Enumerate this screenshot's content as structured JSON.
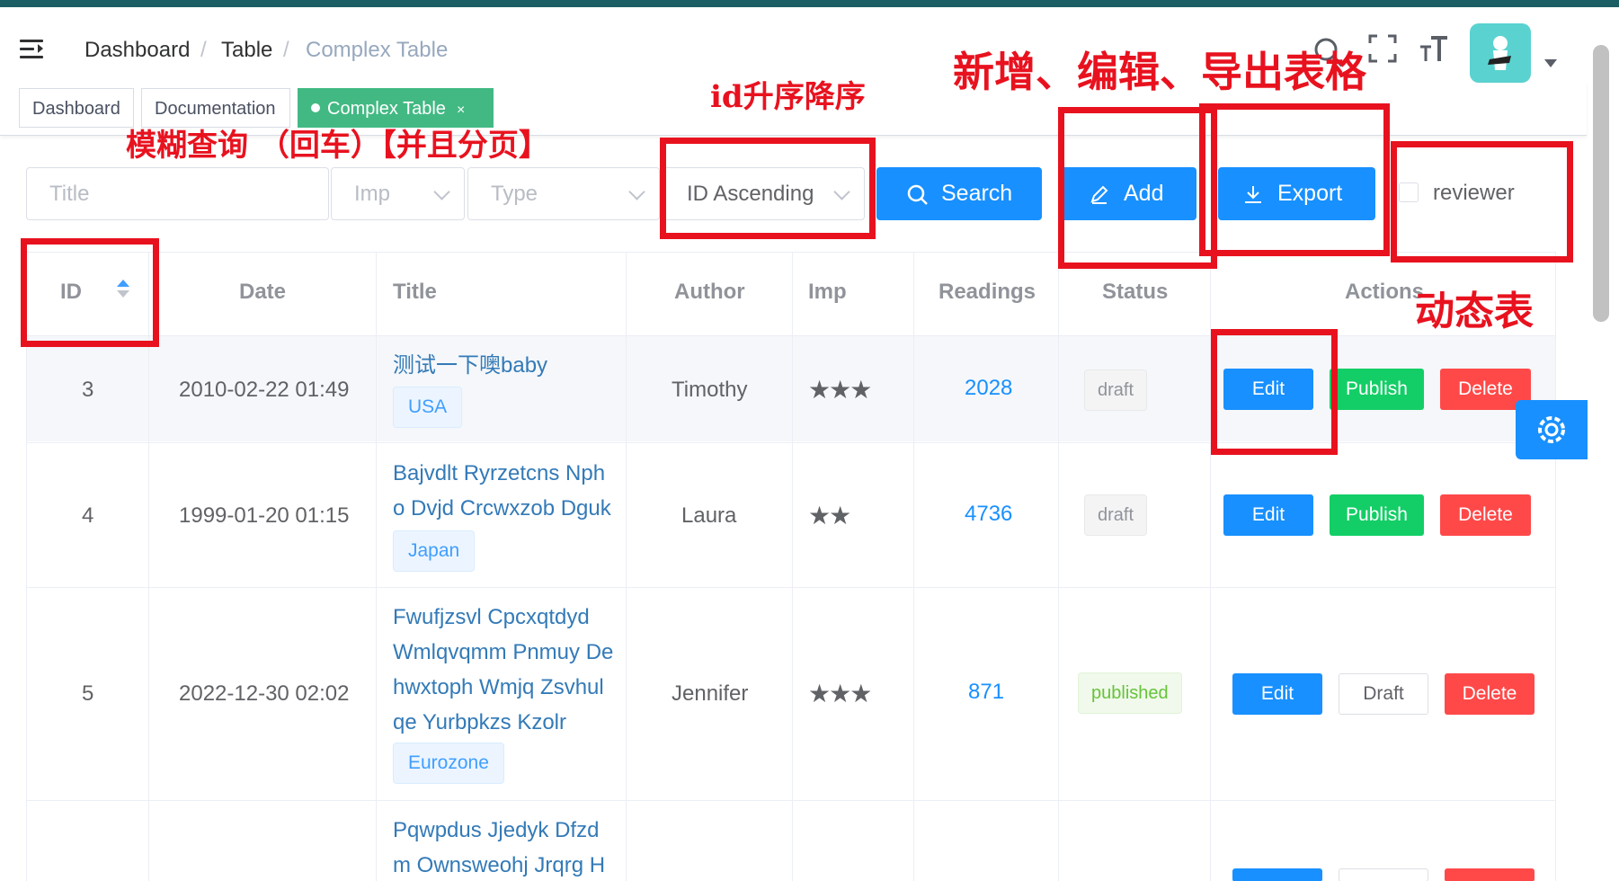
{
  "navbar": {
    "breadcrumb": [
      "Dashboard",
      "Table",
      "Complex Table"
    ],
    "separator": "/"
  },
  "tags": {
    "items": [
      "Dashboard",
      "Documentation",
      "Complex Table"
    ],
    "close": "×"
  },
  "filters": {
    "title_placeholder": "Title",
    "imp_placeholder": "Imp",
    "type_placeholder": "Type",
    "sort_value": "ID Ascending",
    "search_label": "Search",
    "add_label": "Add",
    "export_label": "Export",
    "reviewer_label": "reviewer"
  },
  "table": {
    "headers": [
      "ID",
      "Date",
      "Title",
      "Author",
      "Imp",
      "Readings",
      "Status",
      "Actions"
    ],
    "rows": [
      {
        "id": "3",
        "date": "2010-02-22 01:49",
        "title": [
          "测试一下噢baby"
        ],
        "tag": "USA",
        "author": "Timothy",
        "stars": "★★★",
        "readings": "2028",
        "status": "draft",
        "actions": [
          "Edit",
          "Publish",
          "Delete"
        ]
      },
      {
        "id": "4",
        "date": "1999-01-20 01:15",
        "title": [
          "Bajvdlt Ryrzetcns Nph",
          "o Dvjd Crcwxzob Dguk"
        ],
        "tag": "Japan",
        "author": "Laura",
        "stars": "★★",
        "readings": "4736",
        "status": "draft",
        "actions": [
          "Edit",
          "Publish",
          "Delete"
        ]
      },
      {
        "id": "5",
        "date": "2022-12-30 02:02",
        "title": [
          "Fwufjzsvl Cpcxqtdyd",
          "Wmlqvqmm Pnmuy De",
          "hwxtoph Wmjq Zsvhul",
          "qe Yurbpkzs Kzolr"
        ],
        "tag": "Eurozone",
        "author": "Jennifer",
        "stars": "★★★",
        "readings": "871",
        "status": "published",
        "actions": [
          "Edit",
          "Draft",
          "Delete"
        ]
      },
      {
        "title": [
          "Pqwpdus Jjedyk Dfzd",
          "m Ownsweohj Jrqrg H"
        ]
      }
    ]
  },
  "annotations": {
    "fuzzy_search": "模糊查询 （回车）【并且分页】",
    "id_sort": "id升序降序",
    "add_edit_export": "新增、编辑、导出表格",
    "dynamic_table": "动态表"
  },
  "colors": {
    "primary": "#1890ff",
    "success": "#13ce66",
    "danger": "#ff4949",
    "tag_active": "#42b983",
    "annotation": "#e8121f"
  }
}
